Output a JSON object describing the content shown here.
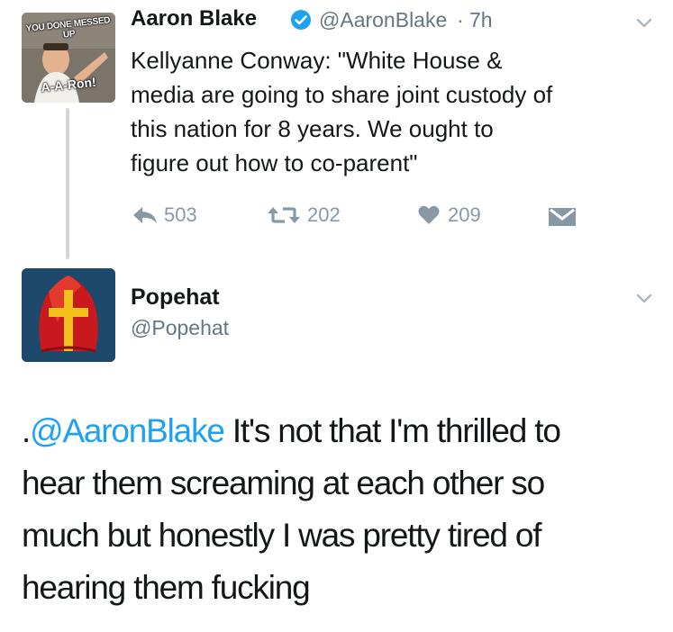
{
  "tweet1": {
    "avatar_meme_top": "YOU DONE MESSED UP",
    "avatar_meme_bottom": "A-A-Ron!",
    "name": "Aaron Blake",
    "handle": "@AaronBlake",
    "dot": "·",
    "time": "7h",
    "text_lines": [
      "Kellyanne Conway: \"White House &",
      "media are going to share joint custody of",
      "this nation for 8 years. We ought to",
      "figure out how to co-parent\""
    ],
    "replies": "503",
    "retweets": "202",
    "likes": "209",
    "icons": {
      "verified": "verified-badge-icon",
      "menu": "chevron-down-icon",
      "reply": "reply-icon",
      "retweet": "retweet-icon",
      "like": "heart-icon",
      "dm": "envelope-icon"
    }
  },
  "tweet2": {
    "name": "Popehat",
    "handle": "@Popehat",
    "text_prefix": ".",
    "mention": "@AaronBlake",
    "text_lines": [
      " It's not that I'm thrilled to",
      "hear them screaming at each other so",
      "much but honestly I was pretty tired of",
      "hearing them fucking"
    ]
  },
  "colors": {
    "accent": "#1da1f2",
    "muted": "#657786",
    "action": "#8899a6",
    "text": "#14171a"
  }
}
